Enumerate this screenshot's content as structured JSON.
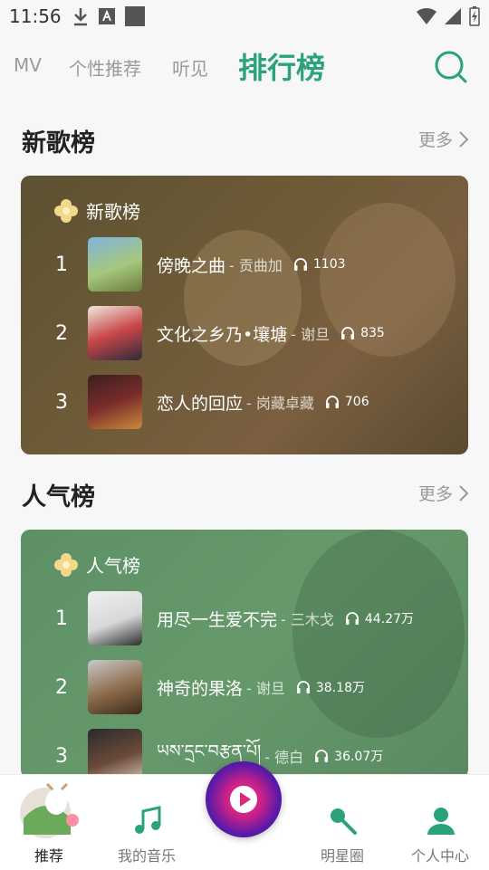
{
  "status": {
    "time": "11:56"
  },
  "nav": {
    "tabs": [
      "MV",
      "个性推荐",
      "听见",
      "排行榜"
    ]
  },
  "sections": {
    "new": {
      "title": "新歌榜",
      "more": "更多"
    },
    "hot": {
      "title": "人气榜",
      "more": "更多"
    }
  },
  "cards": {
    "new": {
      "title": "新歌榜",
      "rows": [
        {
          "rank": "1",
          "song": "傍晚之曲",
          "artist": "- 贡曲加",
          "plays": "1103"
        },
        {
          "rank": "2",
          "song": "文化之乡乃•壤塘",
          "artist": "- 谢旦",
          "plays": "835"
        },
        {
          "rank": "3",
          "song": "恋人的回应",
          "artist": "- 岗藏卓藏",
          "plays": "706"
        }
      ]
    },
    "hot": {
      "title": "人气榜",
      "rows": [
        {
          "rank": "1",
          "song": "用尽一生爱不完",
          "artist": "- 三木戈",
          "plays": "44.27万"
        },
        {
          "rank": "2",
          "song": "神奇的果洛",
          "artist": "- 谢旦",
          "plays": "38.18万"
        },
        {
          "rank": "3",
          "song": "ཡས་དྲང་བརྩན་པོ།",
          "artist": "- 德白",
          "plays": "36.07万"
        }
      ]
    }
  },
  "bottom_tabs": [
    "推荐",
    "我的音乐",
    "明星圈",
    "个人中心"
  ],
  "colors": {
    "accent": "#2aa37c"
  }
}
